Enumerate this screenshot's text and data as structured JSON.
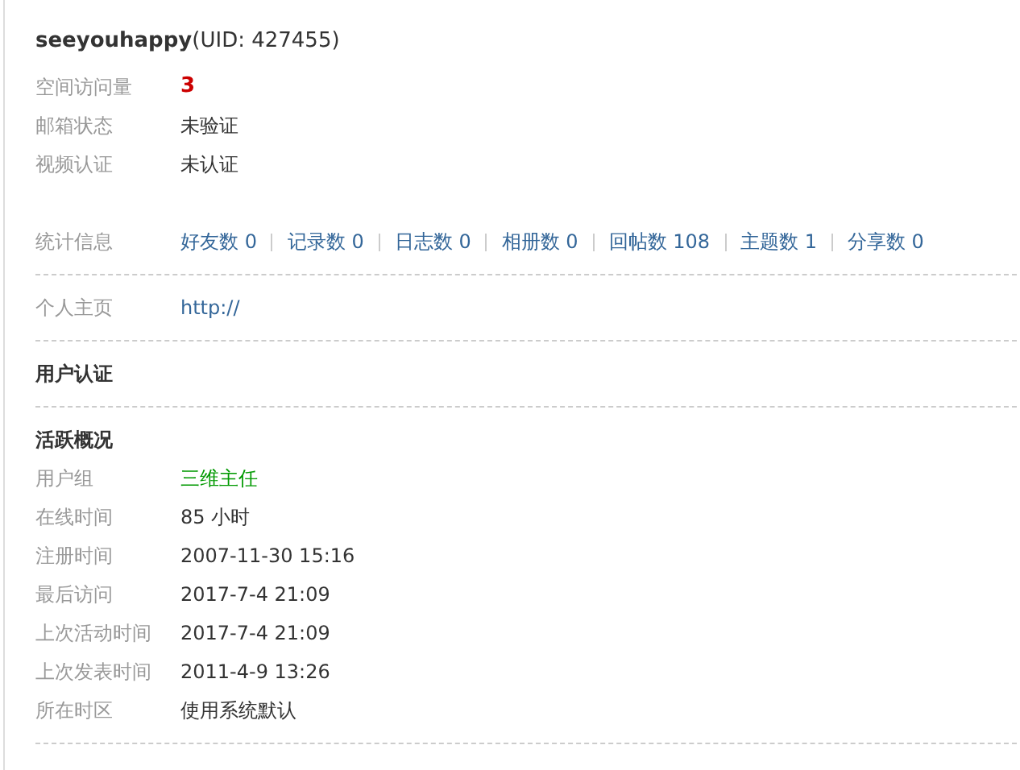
{
  "user": {
    "name": "seeyouhappy",
    "uid": "(UID: 427455)"
  },
  "basic": [
    {
      "label": "空间访问量",
      "value": "3",
      "kind": "count"
    },
    {
      "label": "邮箱状态",
      "value": "未验证",
      "kind": "plain"
    },
    {
      "label": "视频认证",
      "value": "未认证",
      "kind": "plain"
    }
  ],
  "stats": {
    "label": "统计信息",
    "items": [
      {
        "text": "好友数 0"
      },
      {
        "text": "记录数 0"
      },
      {
        "text": "日志数 0"
      },
      {
        "text": "相册数 0"
      },
      {
        "text": "回帖数 108"
      },
      {
        "text": "主题数 1"
      },
      {
        "text": "分享数 0"
      }
    ]
  },
  "homepage": {
    "label": "个人主页",
    "value": "http://"
  },
  "verification": {
    "title": "用户认证"
  },
  "activity": {
    "title": "活跃概况",
    "rows": [
      {
        "label": "用户组",
        "value": "三维主任",
        "kind": "group"
      },
      {
        "label": "在线时间",
        "value": "85 小时",
        "kind": "plain"
      },
      {
        "label": "注册时间",
        "value": "2007-11-30 15:16",
        "kind": "plain"
      },
      {
        "label": "最后访问",
        "value": "2017-7-4 21:09",
        "kind": "plain"
      },
      {
        "label": "上次活动时间",
        "value": "2017-7-4 21:09",
        "kind": "plain"
      },
      {
        "label": "上次发表时间",
        "value": "2011-4-9 13:26",
        "kind": "plain"
      },
      {
        "label": "所在时区",
        "value": "使用系统默认",
        "kind": "plain"
      }
    ]
  }
}
